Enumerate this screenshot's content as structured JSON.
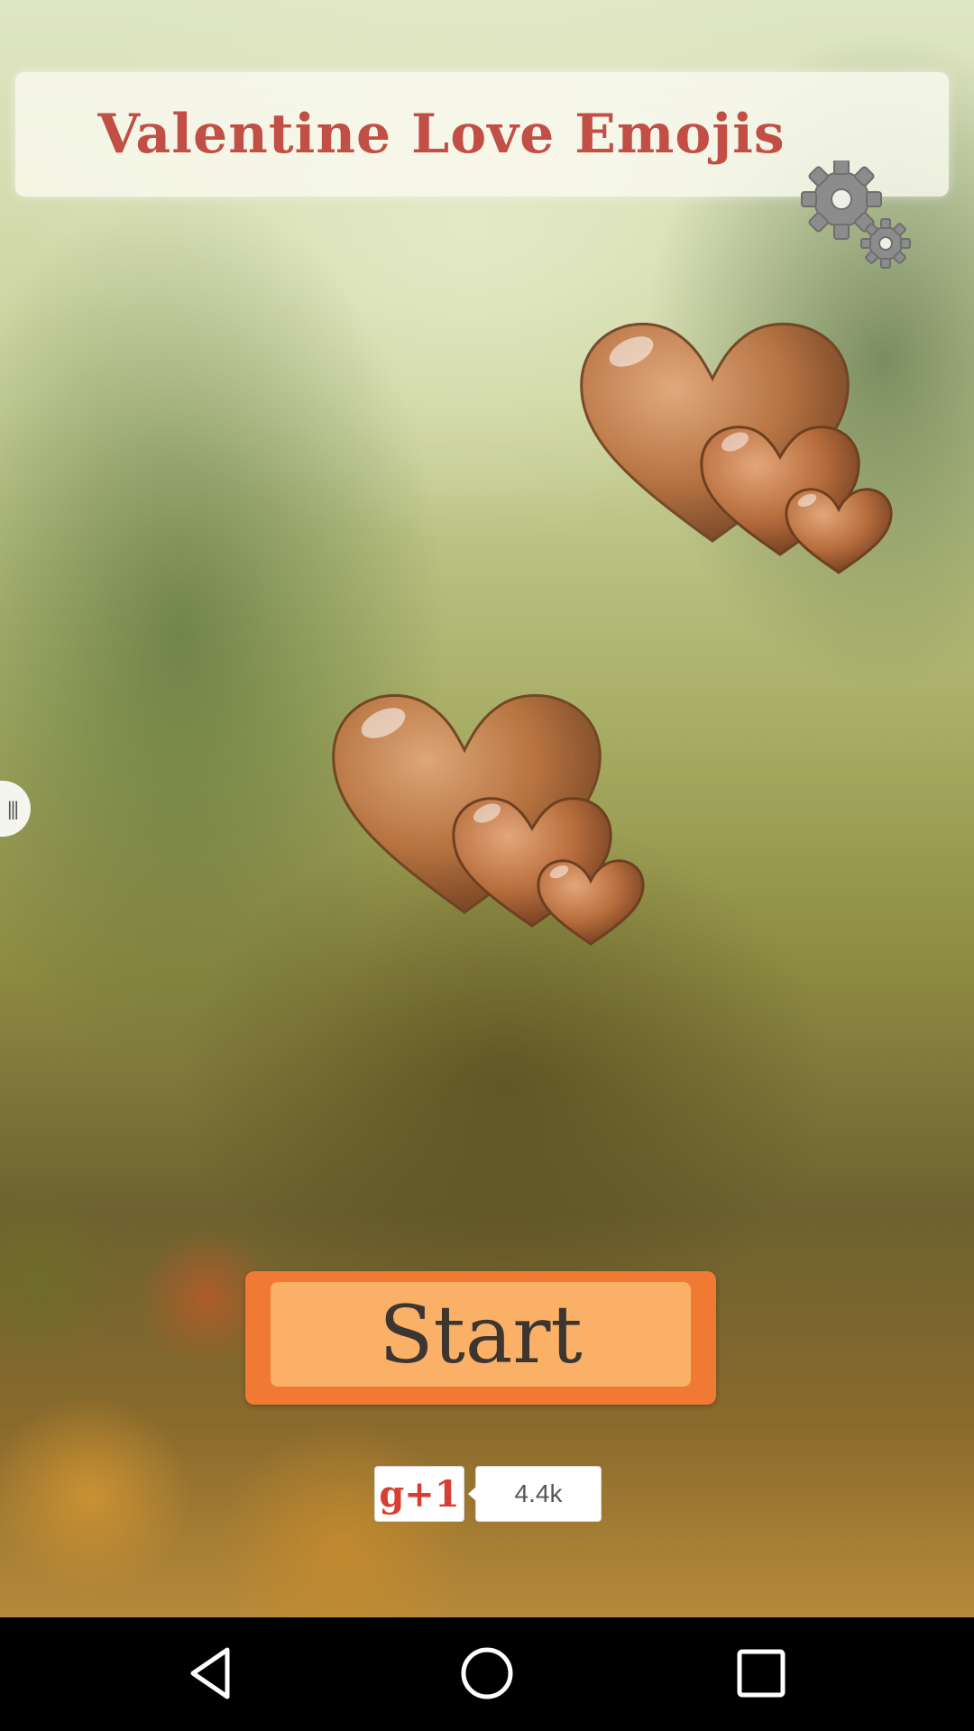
{
  "app": {
    "title": "Valentine Love Emojis",
    "start_label": "Start",
    "gplus_label": "g+1",
    "gplus_count": "4.4k"
  },
  "icons": {
    "settings": "gears-icon",
    "drawer": "menu-handle-icon",
    "hearts": "hearts-icon",
    "back": "back-icon",
    "home": "home-icon",
    "recent": "recent-apps-icon"
  },
  "colors": {
    "title_text": "#c24f45",
    "start_outer": "#f07a33",
    "start_inner": "#fab067",
    "heart": "#b86e3e",
    "gplus_red": "#d73d32"
  }
}
